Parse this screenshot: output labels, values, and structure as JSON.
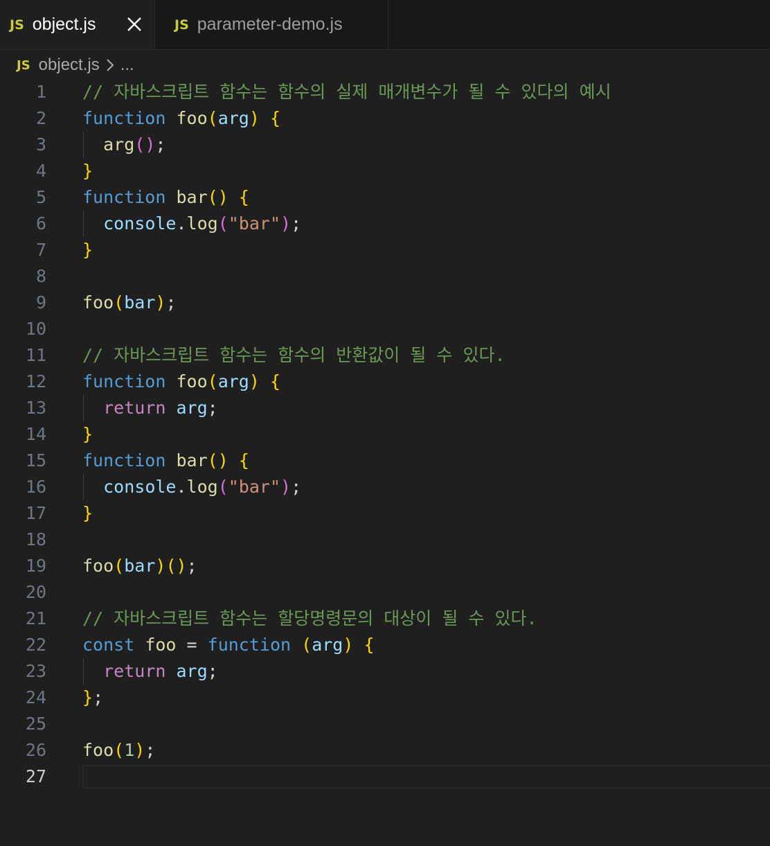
{
  "tabs": [
    {
      "badge": "JS",
      "label": "object.js",
      "active": true,
      "close_icon": "close-icon"
    },
    {
      "badge": "JS",
      "label": "parameter-demo.js",
      "active": false
    }
  ],
  "breadcrumb": {
    "badge": "JS",
    "file": "object.js",
    "separator_icon": "chevron-right-icon",
    "more": "..."
  },
  "editor": {
    "current_line": 27,
    "colors": {
      "keyword": "#569cd6",
      "control": "#c586c0",
      "function": "#dcdcaa",
      "parameter": "#9cdcfe",
      "string": "#ce9178",
      "number": "#b5cea8",
      "comment": "#6a9955",
      "bracket1": "#ffd700",
      "bracket2": "#da70d6"
    },
    "lines": [
      {
        "num": "1",
        "tokens": [
          {
            "t": "// 자바스크립트 함수는 함수의 실제 매개변수가 될 수 있다의 예시",
            "c": "cmt"
          }
        ]
      },
      {
        "num": "2",
        "tokens": [
          {
            "t": "function",
            "c": "kw"
          },
          {
            "t": " ",
            "c": "pl"
          },
          {
            "t": "foo",
            "c": "fn"
          },
          {
            "t": "(",
            "c": "b1"
          },
          {
            "t": "arg",
            "c": "prm"
          },
          {
            "t": ")",
            "c": "b1"
          },
          {
            "t": " ",
            "c": "pl"
          },
          {
            "t": "{",
            "c": "b1"
          }
        ]
      },
      {
        "num": "3",
        "guide": true,
        "tokens": [
          {
            "t": "  ",
            "c": "pl"
          },
          {
            "t": "arg",
            "c": "fn"
          },
          {
            "t": "(",
            "c": "b2"
          },
          {
            "t": ")",
            "c": "b2"
          },
          {
            "t": ";",
            "c": "pl"
          }
        ]
      },
      {
        "num": "4",
        "tokens": [
          {
            "t": "}",
            "c": "b1"
          }
        ]
      },
      {
        "num": "5",
        "tokens": [
          {
            "t": "function",
            "c": "kw"
          },
          {
            "t": " ",
            "c": "pl"
          },
          {
            "t": "bar",
            "c": "fn"
          },
          {
            "t": "()",
            "c": "b1"
          },
          {
            "t": " ",
            "c": "pl"
          },
          {
            "t": "{",
            "c": "b1"
          }
        ]
      },
      {
        "num": "6",
        "guide": true,
        "tokens": [
          {
            "t": "  ",
            "c": "pl"
          },
          {
            "t": "console",
            "c": "prm"
          },
          {
            "t": ".",
            "c": "pl"
          },
          {
            "t": "log",
            "c": "fn"
          },
          {
            "t": "(",
            "c": "b2"
          },
          {
            "t": "\"bar\"",
            "c": "str"
          },
          {
            "t": ")",
            "c": "b2"
          },
          {
            "t": ";",
            "c": "pl"
          }
        ]
      },
      {
        "num": "7",
        "tokens": [
          {
            "t": "}",
            "c": "b1"
          }
        ]
      },
      {
        "num": "8",
        "tokens": []
      },
      {
        "num": "9",
        "tokens": [
          {
            "t": "foo",
            "c": "fn"
          },
          {
            "t": "(",
            "c": "b1"
          },
          {
            "t": "bar",
            "c": "prm"
          },
          {
            "t": ")",
            "c": "b1"
          },
          {
            "t": ";",
            "c": "pl"
          }
        ]
      },
      {
        "num": "10",
        "tokens": []
      },
      {
        "num": "11",
        "tokens": [
          {
            "t": "// 자바스크립트 함수는 함수의 반환값이 될 수 있다.",
            "c": "cmt"
          }
        ]
      },
      {
        "num": "12",
        "tokens": [
          {
            "t": "function",
            "c": "kw"
          },
          {
            "t": " ",
            "c": "pl"
          },
          {
            "t": "foo",
            "c": "fn"
          },
          {
            "t": "(",
            "c": "b1"
          },
          {
            "t": "arg",
            "c": "prm"
          },
          {
            "t": ")",
            "c": "b1"
          },
          {
            "t": " ",
            "c": "pl"
          },
          {
            "t": "{",
            "c": "b1"
          }
        ]
      },
      {
        "num": "13",
        "guide": true,
        "tokens": [
          {
            "t": "  ",
            "c": "pl"
          },
          {
            "t": "return",
            "c": "ctl"
          },
          {
            "t": " ",
            "c": "pl"
          },
          {
            "t": "arg",
            "c": "prm"
          },
          {
            "t": ";",
            "c": "pl"
          }
        ]
      },
      {
        "num": "14",
        "tokens": [
          {
            "t": "}",
            "c": "b1"
          }
        ]
      },
      {
        "num": "15",
        "tokens": [
          {
            "t": "function",
            "c": "kw"
          },
          {
            "t": " ",
            "c": "pl"
          },
          {
            "t": "bar",
            "c": "fn"
          },
          {
            "t": "()",
            "c": "b1"
          },
          {
            "t": " ",
            "c": "pl"
          },
          {
            "t": "{",
            "c": "b1"
          }
        ]
      },
      {
        "num": "16",
        "guide": true,
        "tokens": [
          {
            "t": "  ",
            "c": "pl"
          },
          {
            "t": "console",
            "c": "prm"
          },
          {
            "t": ".",
            "c": "pl"
          },
          {
            "t": "log",
            "c": "fn"
          },
          {
            "t": "(",
            "c": "b2"
          },
          {
            "t": "\"bar\"",
            "c": "str"
          },
          {
            "t": ")",
            "c": "b2"
          },
          {
            "t": ";",
            "c": "pl"
          }
        ]
      },
      {
        "num": "17",
        "tokens": [
          {
            "t": "}",
            "c": "b1"
          }
        ]
      },
      {
        "num": "18",
        "tokens": []
      },
      {
        "num": "19",
        "tokens": [
          {
            "t": "foo",
            "c": "fn"
          },
          {
            "t": "(",
            "c": "b1"
          },
          {
            "t": "bar",
            "c": "prm"
          },
          {
            "t": ")",
            "c": "b1"
          },
          {
            "t": "()",
            "c": "b1"
          },
          {
            "t": ";",
            "c": "pl"
          }
        ]
      },
      {
        "num": "20",
        "tokens": []
      },
      {
        "num": "21",
        "tokens": [
          {
            "t": "// 자바스크립트 함수는 할당명령문의 대상이 될 수 있다.",
            "c": "cmt"
          }
        ]
      },
      {
        "num": "22",
        "tokens": [
          {
            "t": "const",
            "c": "kw"
          },
          {
            "t": " ",
            "c": "pl"
          },
          {
            "t": "foo",
            "c": "fn"
          },
          {
            "t": " = ",
            "c": "pl"
          },
          {
            "t": "function",
            "c": "kw"
          },
          {
            "t": " ",
            "c": "pl"
          },
          {
            "t": "(",
            "c": "b1"
          },
          {
            "t": "arg",
            "c": "prm"
          },
          {
            "t": ")",
            "c": "b1"
          },
          {
            "t": " ",
            "c": "pl"
          },
          {
            "t": "{",
            "c": "b1"
          }
        ]
      },
      {
        "num": "23",
        "guide": true,
        "tokens": [
          {
            "t": "  ",
            "c": "pl"
          },
          {
            "t": "return",
            "c": "ctl"
          },
          {
            "t": " ",
            "c": "pl"
          },
          {
            "t": "arg",
            "c": "prm"
          },
          {
            "t": ";",
            "c": "pl"
          }
        ]
      },
      {
        "num": "24",
        "tokens": [
          {
            "t": "}",
            "c": "b1"
          },
          {
            "t": ";",
            "c": "pl"
          }
        ]
      },
      {
        "num": "25",
        "tokens": []
      },
      {
        "num": "26",
        "tokens": [
          {
            "t": "foo",
            "c": "fn"
          },
          {
            "t": "(",
            "c": "b1"
          },
          {
            "t": "1",
            "c": "num"
          },
          {
            "t": ")",
            "c": "b1"
          },
          {
            "t": ";",
            "c": "pl"
          }
        ]
      },
      {
        "num": "27",
        "tokens": []
      }
    ]
  }
}
